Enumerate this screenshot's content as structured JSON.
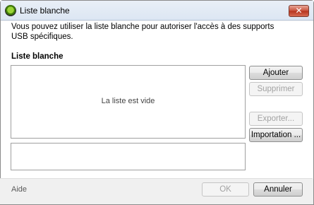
{
  "window": {
    "title": "Liste blanche",
    "close_glyph": "✕",
    "app_icon": "shield-icon"
  },
  "main": {
    "intro_text": "Vous pouvez utiliser la liste blanche pour autoriser l'accès à des supports USB spécifiques.",
    "section_label": "Liste blanche",
    "list_empty_text": "La liste est vide"
  },
  "side_buttons": {
    "add": "Ajouter",
    "remove": "Supprimer",
    "export": "Exporter...",
    "import": "Importation ..."
  },
  "footer": {
    "help": "Aide",
    "ok": "OK",
    "cancel": "Annuler"
  }
}
